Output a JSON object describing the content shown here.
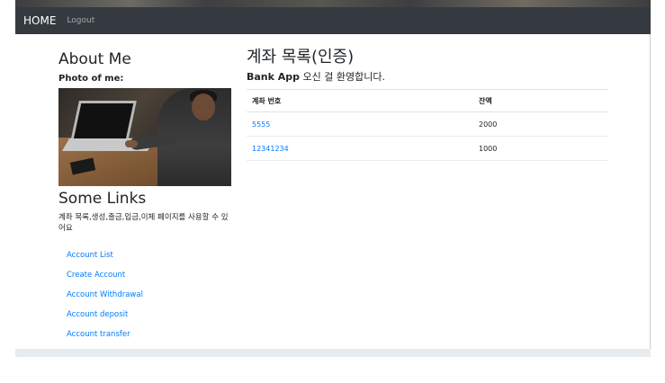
{
  "navbar": {
    "brand": "HOME",
    "logout": "Logout"
  },
  "sidebar": {
    "about_title": "About Me",
    "photo_label": "Photo of me:",
    "links_title": "Some Links",
    "description": "계좌 목록,생성,출금,입금,이체 페이지를 사용할 수 있어요",
    "links": [
      {
        "label": "Account List"
      },
      {
        "label": "Create Account"
      },
      {
        "label": "Account Withdrawal"
      },
      {
        "label": "Account deposit"
      },
      {
        "label": "Account transfer"
      }
    ]
  },
  "main": {
    "title": "계좌 목록(인증)",
    "welcome_bold": "Bank App",
    "welcome_rest": " 오신 걸 환영합니다.",
    "table": {
      "headers": [
        "계좌 번호",
        "잔액"
      ],
      "rows": [
        {
          "number": "5555",
          "balance": "2000"
        },
        {
          "number": "12341234",
          "balance": "1000"
        }
      ]
    }
  },
  "colors": {
    "navbar_bg": "#343a40",
    "link": "#007bff",
    "footer_bg": "#e9ecef"
  }
}
